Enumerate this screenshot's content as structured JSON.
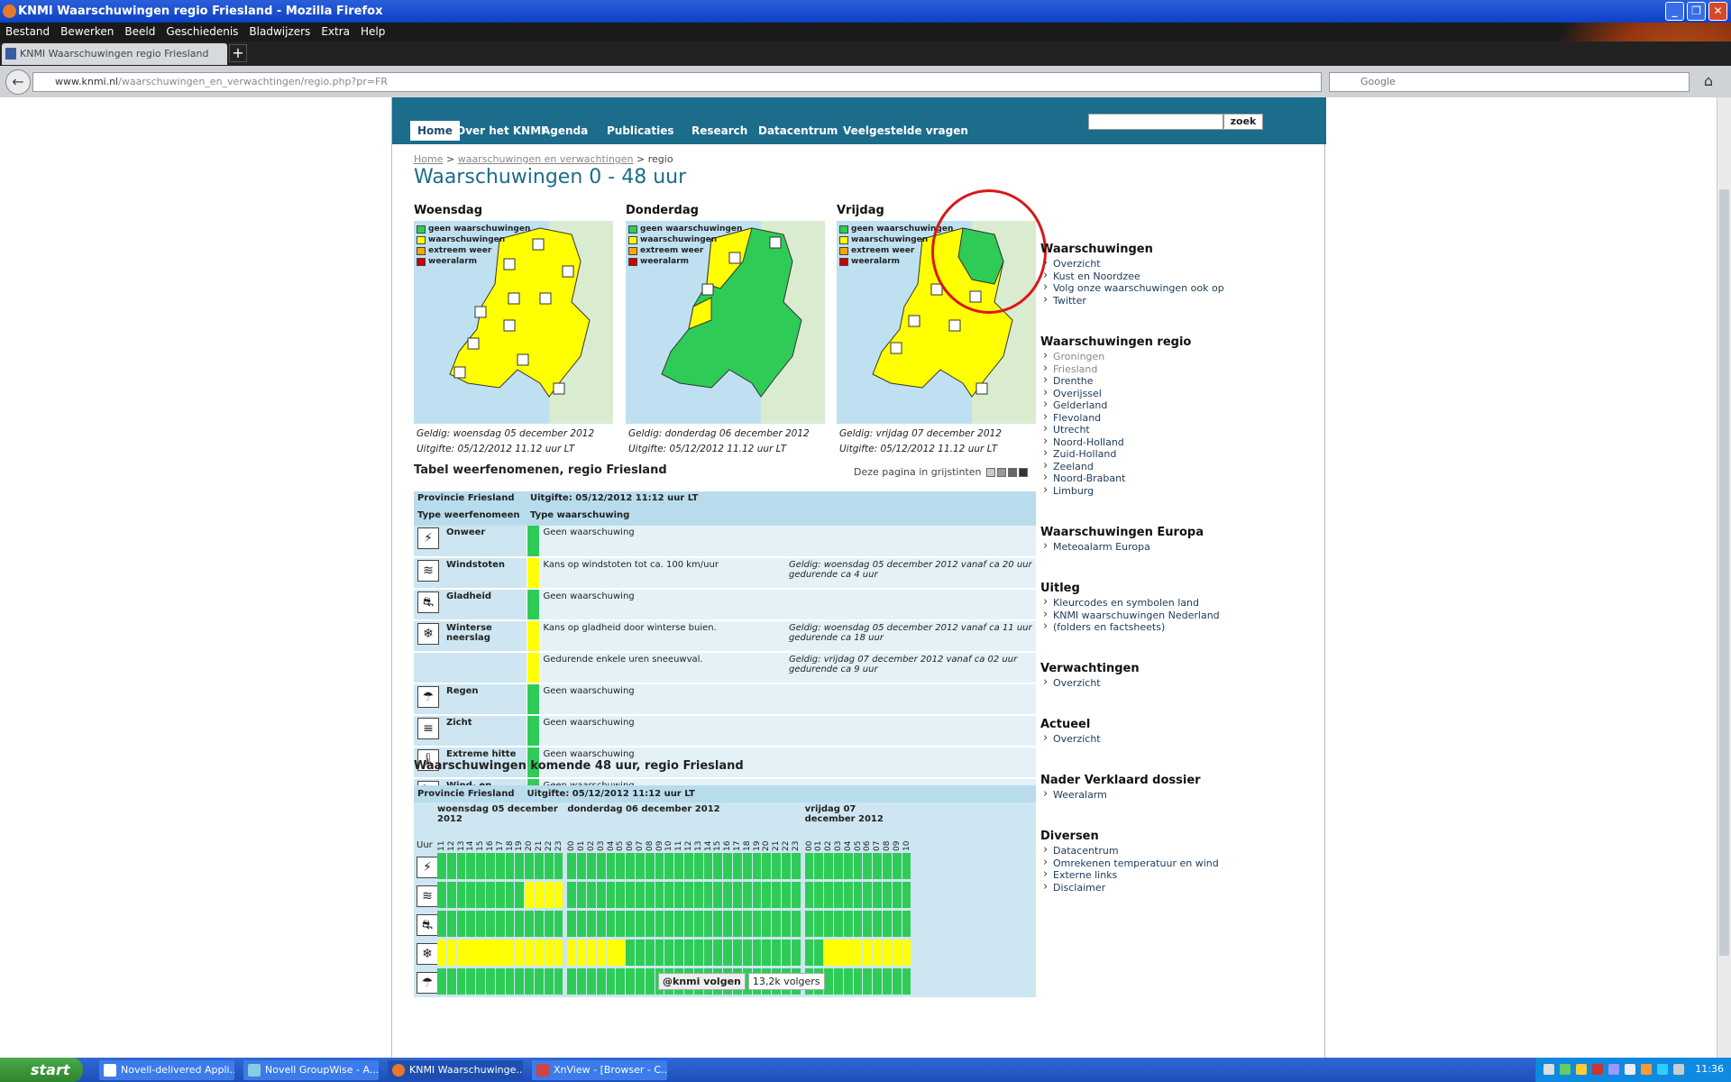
{
  "window": {
    "title": "KNMI Waarschuwingen regio Friesland - Mozilla Firefox"
  },
  "menu": [
    "Bestand",
    "Bewerken",
    "Beeld",
    "Geschiedenis",
    "Bladwijzers",
    "Extra",
    "Help"
  ],
  "tab": {
    "label": "KNMI Waarschuwingen regio Friesland"
  },
  "address": {
    "domain": "www.knmi.nl",
    "path": "/waarschuwingen_en_verwachtingen/regio.php?pr=FR"
  },
  "browser_search": {
    "placeholder": "Google"
  },
  "site_nav": [
    "Home",
    "Over het KNMI",
    "Agenda",
    "Publicaties",
    "Research",
    "Datacentrum",
    "Veelgestelde vragen"
  ],
  "site_search": {
    "button": "zoek"
  },
  "breadcrumb": {
    "home": "Home",
    "section": "waarschuwingen en verwachtingen",
    "current": "regio"
  },
  "page_title": "Waarschuwingen 0 - 48 uur",
  "legend": [
    "geen waarschuwingen",
    "waarschuwingen",
    "extreem weer",
    "weeralarm"
  ],
  "colors": {
    "green": "#2ecc57",
    "yellow": "#ffff00",
    "orange": "#ffa500",
    "red": "#cc0000",
    "header": "#1c6c8c"
  },
  "maps": [
    {
      "day": "Woensdag",
      "valid": "Geldig: woensdag 05 december 2012",
      "issued": "Uitgifte: 05/12/2012 11.12 uur LT"
    },
    {
      "day": "Donderdag",
      "valid": "Geldig: donderdag 06 december 2012",
      "issued": "Uitgifte: 05/12/2012 11.12 uur LT"
    },
    {
      "day": "Vrijdag",
      "valid": "Geldig: vrijdag 07 december 2012",
      "issued": "Uitgifte: 05/12/2012 11.12 uur LT"
    }
  ],
  "table_title": "Tabel weerfenomenen, regio Friesland",
  "grayscale_label": "Deze pagina in grijstinten",
  "table": {
    "province": "Provincie Friesland",
    "issued": "Uitgifte: 05/12/2012 11:12 uur LT",
    "col1": "Type weerfenomeen",
    "col2": "Type waarschuwing",
    "rows": [
      {
        "icon": "lightning-icon",
        "name": "Onweer",
        "text": "Geen waarschuwing",
        "valid": "",
        "level": "green"
      },
      {
        "icon": "wind-icon",
        "name": "Windstoten",
        "text": "Kans op windstoten tot ca. 100 km/uur",
        "valid": "Geldig: woensdag 05 december 2012 vanaf ca 20 uur gedurende ca 4 uur",
        "level": "yellow"
      },
      {
        "icon": "slippery-icon",
        "name": "Gladheid",
        "text": "Geen waarschuwing",
        "valid": "",
        "level": "green"
      },
      {
        "icon": "snowflake-icon",
        "name": "Winterse neerslag",
        "text": "Kans op gladheid door winterse buien.",
        "valid": "Geldig: woensdag 05 december 2012 vanaf ca 11 uur gedurende ca 18 uur",
        "level": "yellow"
      },
      {
        "icon": "",
        "name": "",
        "text": "Gedurende enkele uren sneeuwval.",
        "valid": "Geldig: vrijdag 07 december 2012 vanaf ca 02 uur gedurende ca 9 uur",
        "level": "yellow"
      },
      {
        "icon": "rain-icon",
        "name": "Regen",
        "text": "Geen waarschuwing",
        "valid": "",
        "level": "green"
      },
      {
        "icon": "visibility-icon",
        "name": "Zicht",
        "text": "Geen waarschuwing",
        "valid": "",
        "level": "green"
      },
      {
        "icon": "thermometer-icon",
        "name": "Extreme hitte",
        "text": "Geen waarschuwing",
        "valid": "",
        "level": "green"
      },
      {
        "icon": "waterspout-icon",
        "name": "Wind- en waterhozen",
        "text": "Geen waarschuwing",
        "valid": "",
        "level": "green"
      }
    ]
  },
  "forecast48": {
    "title": "Waarschuwingen komende 48 uur, regio Friesland",
    "province": "Provincie Friesland",
    "issued": "Uitgifte: 05/12/2012 11:12 uur LT",
    "hour_label": "Uur",
    "days": [
      {
        "label": "woensdag 05 december 2012",
        "hours": [
          "11",
          "12",
          "13",
          "14",
          "15",
          "16",
          "17",
          "18",
          "19",
          "20",
          "21",
          "22",
          "23"
        ]
      },
      {
        "label": "donderdag 06 december 2012",
        "hours": [
          "00",
          "01",
          "02",
          "03",
          "04",
          "05",
          "06",
          "07",
          "08",
          "09",
          "10",
          "11",
          "12",
          "13",
          "14",
          "15",
          "16",
          "17",
          "18",
          "19",
          "20",
          "21",
          "22",
          "23"
        ]
      },
      {
        "label": "vrijdag 07 december 2012",
        "hours": [
          "00",
          "01",
          "02",
          "03",
          "04",
          "05",
          "06",
          "07",
          "08",
          "09",
          "10"
        ]
      }
    ],
    "rows": [
      {
        "icon": "lightning-icon",
        "yellow_hours": []
      },
      {
        "icon": "wind-icon",
        "yellow_hours": [
          9,
          10,
          11,
          12
        ]
      },
      {
        "icon": "slippery-icon",
        "yellow_hours": []
      },
      {
        "icon": "snowflake-icon",
        "yellow_hours": [
          0,
          1,
          2,
          3,
          4,
          5,
          6,
          7,
          8,
          9,
          10,
          11,
          12,
          13,
          14,
          15,
          16,
          17,
          18,
          39,
          40,
          41,
          42,
          43,
          44,
          45,
          46,
          47
        ]
      },
      {
        "icon": "rain-icon",
        "yellow_hours": []
      }
    ]
  },
  "sidebar": {
    "waarschuwingen": {
      "title": "Waarschuwingen",
      "links": [
        "Overzicht",
        "Kust en Noordzee",
        "Volg onze waarschuwingen ook op",
        "Twitter"
      ]
    },
    "regio": {
      "title": "Waarschuwingen regio",
      "links": [
        "Groningen",
        "Friesland",
        "Drenthe",
        "Overijssel",
        "Gelderland",
        "Flevoland",
        "Utrecht",
        "Noord-Holland",
        "Zuid-Holland",
        "Zeeland",
        "Noord-Brabant",
        "Limburg"
      ]
    },
    "europa": {
      "title": "Waarschuwingen Europa",
      "links": [
        "Meteoalarm Europa"
      ]
    },
    "uitleg": {
      "title": "Uitleg",
      "links": [
        "Kleurcodes en symbolen land",
        "KNMI waarschuwingen Nederland",
        "(folders en factsheets)"
      ]
    },
    "verwachtingen": {
      "title": "Verwachtingen",
      "links": [
        "Overzicht"
      ]
    },
    "actueel": {
      "title": "Actueel",
      "links": [
        "Overzicht"
      ]
    },
    "dossier": {
      "title": "Nader Verklaard dossier",
      "links": [
        "Weeralarm"
      ]
    },
    "diversen": {
      "title": "Diversen",
      "links": [
        "Datacentrum",
        "Omrekenen temperatuur en wind",
        "Externe links",
        "Disclaimer"
      ]
    },
    "twitter": {
      "button": "@knmi volgen",
      "followers": "13,2k volgers"
    }
  },
  "taskbar": {
    "start": "start",
    "items": [
      "Novell-delivered Appli...",
      "Novell GroupWise - A...",
      "KNMI Waarschuwinge...",
      "XnView - [Browser - C..."
    ],
    "clock": "11:36"
  }
}
